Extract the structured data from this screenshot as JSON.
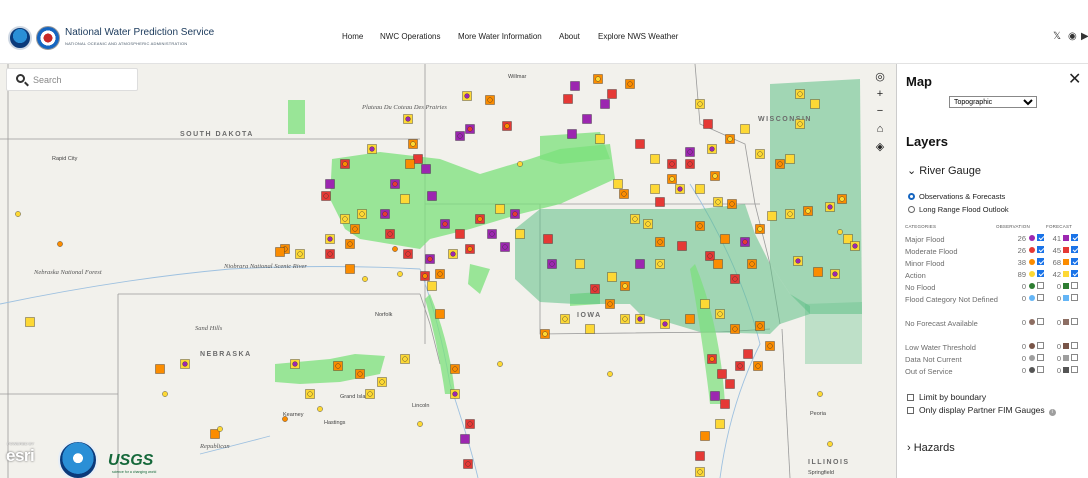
{
  "header": {
    "title": "National Water Prediction Service",
    "subtitle": "NATIONAL OCEANIC AND ATMOSPHERIC ADMINISTRATION",
    "nav": [
      "Home",
      "NWC Operations",
      "More Water Information",
      "About",
      "Explore NWS Weather"
    ],
    "icons": [
      "x-twitter-icon",
      "github-icon",
      "youtube-icon"
    ]
  },
  "search": {
    "placeholder": "Search"
  },
  "map": {
    "states": [
      "SOUTH DAKOTA",
      "NEBRASKA",
      "IOWA",
      "WISCONSIN",
      "ILLINOIS"
    ],
    "places": [
      "Willmar",
      "Rapid City",
      "Plateau Du Coteau Des Prairies",
      "Niobrara National Scenic River",
      "Nebraska National Forest",
      "Sand Hills",
      "Norfolk",
      "Grand Island",
      "Kearney",
      "Hastings",
      "Lincoln",
      "Peoria",
      "Springfield",
      "Republican"
    ],
    "controls": [
      "locate-icon",
      "zoom-in-icon",
      "zoom-out-icon",
      "home-icon",
      "layers-icon"
    ],
    "attribution": {
      "esri": "esri",
      "esri_powered": "POWERED BY",
      "usgs": "USGS",
      "usgs_tag": "science for a changing world"
    }
  },
  "panel": {
    "title": "Map",
    "basemap": "Topographic",
    "layers_title": "Layers",
    "river_gauge": "River Gauge",
    "radio_options": [
      "Observations & Forecasts",
      "Long Range Flood Outlook"
    ],
    "columns": {
      "categories": "CATEGORIES",
      "observation": "OBSERVATION",
      "forecast": "FORECAST"
    },
    "categories": [
      {
        "label": "Major Flood",
        "obs": "26",
        "fc": "41",
        "color": "#9c27b0",
        "checked": true
      },
      {
        "label": "Moderate Flood",
        "obs": "26",
        "fc": "45",
        "color": "#e53935",
        "checked": true
      },
      {
        "label": "Minor Flood",
        "obs": "38",
        "fc": "68",
        "color": "#fb8c00",
        "checked": true
      },
      {
        "label": "Action",
        "obs": "89",
        "fc": "42",
        "color": "#fdd835",
        "checked": true
      },
      {
        "label": "No Flood",
        "obs": "0",
        "fc": "0",
        "color": "#2e7d32",
        "checked": false
      },
      {
        "label": "Flood Category Not Defined",
        "obs": "0",
        "fc": "0",
        "color": "#64b5f6",
        "checked": false
      },
      {
        "label": "No Forecast Available",
        "obs": "0",
        "fc": "0",
        "color": "#8d6e63",
        "checked": false
      },
      {
        "label": "Low Water Threshold",
        "obs": "0",
        "fc": "0",
        "color": "#795548",
        "checked": false
      },
      {
        "label": "Data Not Current",
        "obs": "0",
        "fc": "0",
        "color": "#9e9e9e",
        "checked": false
      },
      {
        "label": "Out of Service",
        "obs": "0",
        "fc": "0",
        "color": "#555555",
        "checked": false
      }
    ],
    "options": [
      "Limit by boundary",
      "Only display Partner FIM Gauges"
    ],
    "hazards": "Hazards"
  }
}
